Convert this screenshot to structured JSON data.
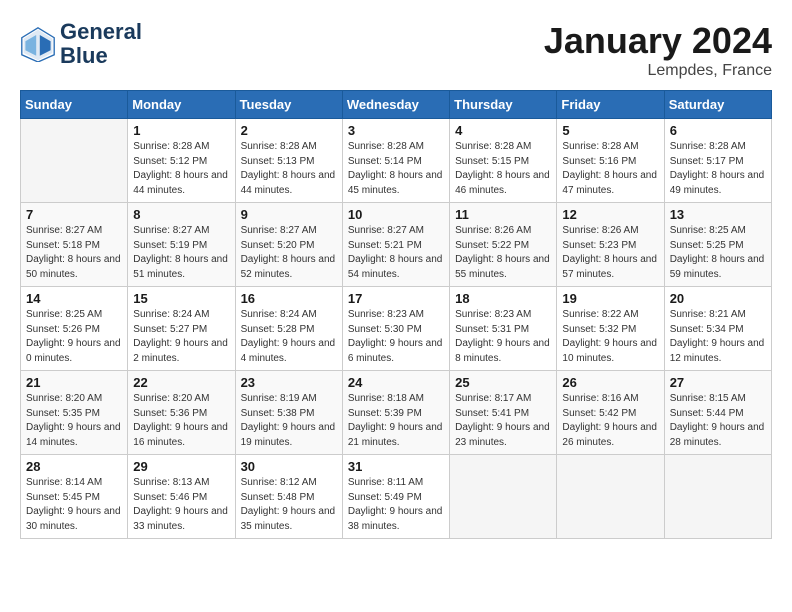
{
  "header": {
    "logo_line1": "General",
    "logo_line2": "Blue",
    "month": "January 2024",
    "location": "Lempdes, France"
  },
  "weekdays": [
    "Sunday",
    "Monday",
    "Tuesday",
    "Wednesday",
    "Thursday",
    "Friday",
    "Saturday"
  ],
  "weeks": [
    [
      {
        "day": "",
        "sunrise": "",
        "sunset": "",
        "daylight": ""
      },
      {
        "day": "1",
        "sunrise": "Sunrise: 8:28 AM",
        "sunset": "Sunset: 5:12 PM",
        "daylight": "Daylight: 8 hours and 44 minutes."
      },
      {
        "day": "2",
        "sunrise": "Sunrise: 8:28 AM",
        "sunset": "Sunset: 5:13 PM",
        "daylight": "Daylight: 8 hours and 44 minutes."
      },
      {
        "day": "3",
        "sunrise": "Sunrise: 8:28 AM",
        "sunset": "Sunset: 5:14 PM",
        "daylight": "Daylight: 8 hours and 45 minutes."
      },
      {
        "day": "4",
        "sunrise": "Sunrise: 8:28 AM",
        "sunset": "Sunset: 5:15 PM",
        "daylight": "Daylight: 8 hours and 46 minutes."
      },
      {
        "day": "5",
        "sunrise": "Sunrise: 8:28 AM",
        "sunset": "Sunset: 5:16 PM",
        "daylight": "Daylight: 8 hours and 47 minutes."
      },
      {
        "day": "6",
        "sunrise": "Sunrise: 8:28 AM",
        "sunset": "Sunset: 5:17 PM",
        "daylight": "Daylight: 8 hours and 49 minutes."
      }
    ],
    [
      {
        "day": "7",
        "sunrise": "Sunrise: 8:27 AM",
        "sunset": "Sunset: 5:18 PM",
        "daylight": "Daylight: 8 hours and 50 minutes."
      },
      {
        "day": "8",
        "sunrise": "Sunrise: 8:27 AM",
        "sunset": "Sunset: 5:19 PM",
        "daylight": "Daylight: 8 hours and 51 minutes."
      },
      {
        "day": "9",
        "sunrise": "Sunrise: 8:27 AM",
        "sunset": "Sunset: 5:20 PM",
        "daylight": "Daylight: 8 hours and 52 minutes."
      },
      {
        "day": "10",
        "sunrise": "Sunrise: 8:27 AM",
        "sunset": "Sunset: 5:21 PM",
        "daylight": "Daylight: 8 hours and 54 minutes."
      },
      {
        "day": "11",
        "sunrise": "Sunrise: 8:26 AM",
        "sunset": "Sunset: 5:22 PM",
        "daylight": "Daylight: 8 hours and 55 minutes."
      },
      {
        "day": "12",
        "sunrise": "Sunrise: 8:26 AM",
        "sunset": "Sunset: 5:23 PM",
        "daylight": "Daylight: 8 hours and 57 minutes."
      },
      {
        "day": "13",
        "sunrise": "Sunrise: 8:25 AM",
        "sunset": "Sunset: 5:25 PM",
        "daylight": "Daylight: 8 hours and 59 minutes."
      }
    ],
    [
      {
        "day": "14",
        "sunrise": "Sunrise: 8:25 AM",
        "sunset": "Sunset: 5:26 PM",
        "daylight": "Daylight: 9 hours and 0 minutes."
      },
      {
        "day": "15",
        "sunrise": "Sunrise: 8:24 AM",
        "sunset": "Sunset: 5:27 PM",
        "daylight": "Daylight: 9 hours and 2 minutes."
      },
      {
        "day": "16",
        "sunrise": "Sunrise: 8:24 AM",
        "sunset": "Sunset: 5:28 PM",
        "daylight": "Daylight: 9 hours and 4 minutes."
      },
      {
        "day": "17",
        "sunrise": "Sunrise: 8:23 AM",
        "sunset": "Sunset: 5:30 PM",
        "daylight": "Daylight: 9 hours and 6 minutes."
      },
      {
        "day": "18",
        "sunrise": "Sunrise: 8:23 AM",
        "sunset": "Sunset: 5:31 PM",
        "daylight": "Daylight: 9 hours and 8 minutes."
      },
      {
        "day": "19",
        "sunrise": "Sunrise: 8:22 AM",
        "sunset": "Sunset: 5:32 PM",
        "daylight": "Daylight: 9 hours and 10 minutes."
      },
      {
        "day": "20",
        "sunrise": "Sunrise: 8:21 AM",
        "sunset": "Sunset: 5:34 PM",
        "daylight": "Daylight: 9 hours and 12 minutes."
      }
    ],
    [
      {
        "day": "21",
        "sunrise": "Sunrise: 8:20 AM",
        "sunset": "Sunset: 5:35 PM",
        "daylight": "Daylight: 9 hours and 14 minutes."
      },
      {
        "day": "22",
        "sunrise": "Sunrise: 8:20 AM",
        "sunset": "Sunset: 5:36 PM",
        "daylight": "Daylight: 9 hours and 16 minutes."
      },
      {
        "day": "23",
        "sunrise": "Sunrise: 8:19 AM",
        "sunset": "Sunset: 5:38 PM",
        "daylight": "Daylight: 9 hours and 19 minutes."
      },
      {
        "day": "24",
        "sunrise": "Sunrise: 8:18 AM",
        "sunset": "Sunset: 5:39 PM",
        "daylight": "Daylight: 9 hours and 21 minutes."
      },
      {
        "day": "25",
        "sunrise": "Sunrise: 8:17 AM",
        "sunset": "Sunset: 5:41 PM",
        "daylight": "Daylight: 9 hours and 23 minutes."
      },
      {
        "day": "26",
        "sunrise": "Sunrise: 8:16 AM",
        "sunset": "Sunset: 5:42 PM",
        "daylight": "Daylight: 9 hours and 26 minutes."
      },
      {
        "day": "27",
        "sunrise": "Sunrise: 8:15 AM",
        "sunset": "Sunset: 5:44 PM",
        "daylight": "Daylight: 9 hours and 28 minutes."
      }
    ],
    [
      {
        "day": "28",
        "sunrise": "Sunrise: 8:14 AM",
        "sunset": "Sunset: 5:45 PM",
        "daylight": "Daylight: 9 hours and 30 minutes."
      },
      {
        "day": "29",
        "sunrise": "Sunrise: 8:13 AM",
        "sunset": "Sunset: 5:46 PM",
        "daylight": "Daylight: 9 hours and 33 minutes."
      },
      {
        "day": "30",
        "sunrise": "Sunrise: 8:12 AM",
        "sunset": "Sunset: 5:48 PM",
        "daylight": "Daylight: 9 hours and 35 minutes."
      },
      {
        "day": "31",
        "sunrise": "Sunrise: 8:11 AM",
        "sunset": "Sunset: 5:49 PM",
        "daylight": "Daylight: 9 hours and 38 minutes."
      },
      {
        "day": "",
        "sunrise": "",
        "sunset": "",
        "daylight": ""
      },
      {
        "day": "",
        "sunrise": "",
        "sunset": "",
        "daylight": ""
      },
      {
        "day": "",
        "sunrise": "",
        "sunset": "",
        "daylight": ""
      }
    ]
  ]
}
